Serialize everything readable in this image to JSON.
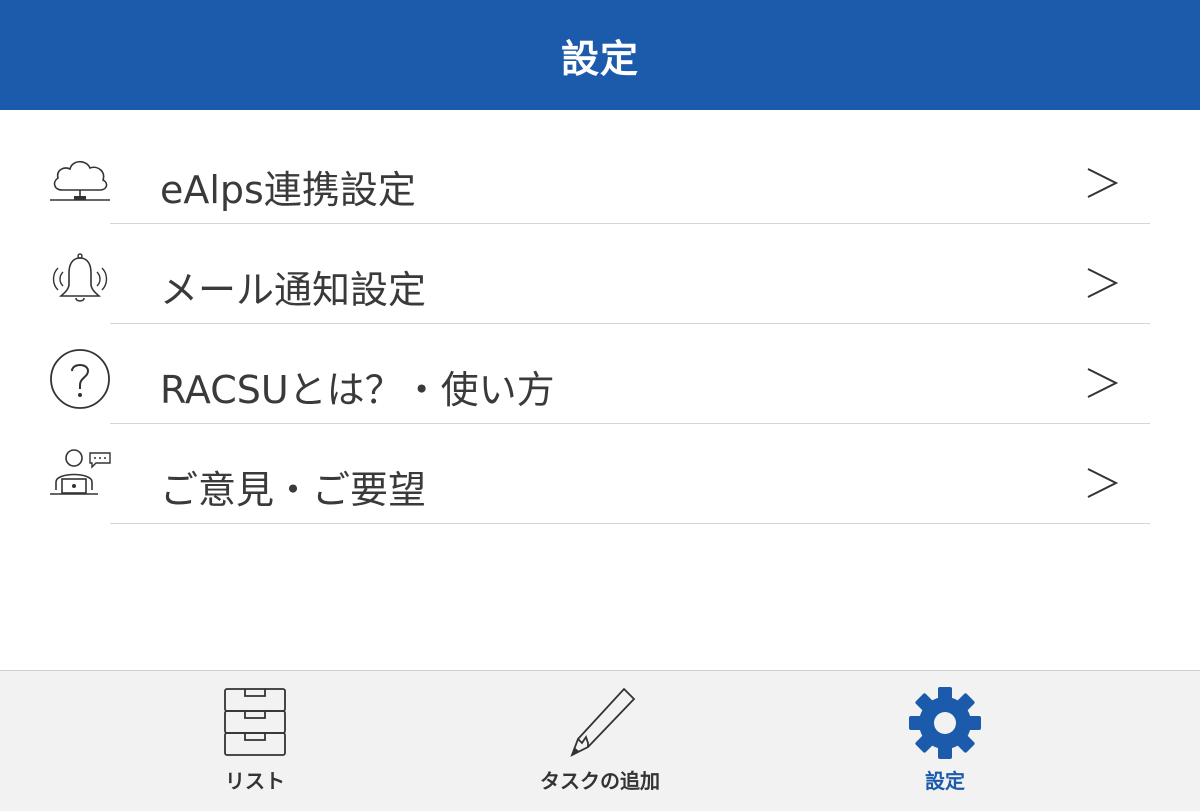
{
  "header": {
    "title": "設定"
  },
  "menu": {
    "items": [
      {
        "label": "eAlps連携設定",
        "icon": "cloud-network-icon"
      },
      {
        "label": "メール通知設定",
        "icon": "ringing-bell-icon"
      },
      {
        "label": "RACSUとは？・使い方",
        "icon": "question-circle-icon"
      },
      {
        "label": "ご意見・ご要望",
        "icon": "person-feedback-icon"
      }
    ],
    "chevron": ">"
  },
  "tabbar": {
    "tabs": [
      {
        "label": "リスト",
        "icon": "drawer-cabinet-icon",
        "active": false
      },
      {
        "label": "タスクの追加",
        "icon": "pencil-icon",
        "active": false
      },
      {
        "label": "設定",
        "icon": "gear-icon",
        "active": true
      }
    ]
  },
  "colors": {
    "accent": "#1c5aab",
    "text": "#3a3a3a",
    "divider": "#d6d6d6",
    "tabbar_bg": "#f2f2f2"
  }
}
